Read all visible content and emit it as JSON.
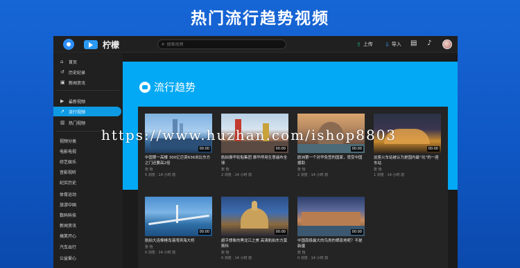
{
  "banner": {
    "title": "热门流行趋势视频"
  },
  "app": {
    "brand": "柠檬",
    "search_placeholder": "搜索视频",
    "upload_label": "上传",
    "import_label": "导入"
  },
  "sidebar": {
    "main_items": [
      {
        "label": "首页",
        "icon": "home-icon"
      },
      {
        "label": "历史纪录",
        "icon": "history-icon"
      },
      {
        "label": "新闻资讯",
        "icon": "news-icon"
      }
    ],
    "video_items": [
      {
        "label": "最新视频",
        "icon": "video-icon"
      },
      {
        "label": "流行视频",
        "icon": "trending-icon",
        "active": true
      },
      {
        "label": "热门视频",
        "icon": "chart-icon"
      }
    ],
    "categories": [
      "视频分类",
      "电影电视",
      "综艺娱乐",
      "音影视听",
      "纪实历史",
      "体育运动",
      "旅游中国",
      "数码科技",
      "新闻资讯",
      "搞笑开心",
      "汽车出行",
      "公益爱心"
    ]
  },
  "main": {
    "hero_title": "流行趋势",
    "hero_color": "#03a9f4",
    "videos": [
      {
        "title": "中国第一高楼 300亿巨资636米比东方之门还要高2倍",
        "author": "张 怡",
        "meta": "5 浏览 · 14 小时 前",
        "duration": "00:00"
      },
      {
        "title": "航拍振华轮船集团 振华停用生意遍布全球",
        "author": "张 怡",
        "meta": "2 浏览 · 14 小时 前",
        "duration": "00:00"
      },
      {
        "title": "欧洲第一个对华免签的国家，竟受中国援助",
        "author": "张 怡",
        "meta": "2 浏览 · 14 小时 前",
        "duration": "00:00"
      },
      {
        "title": "这座火车站被认为是国内最“坑”的一座车站",
        "author": "张 怡",
        "meta": "1 浏览 · 14 小时 前",
        "duration": "00:00"
      },
      {
        "title": "航拍大连棒棰岛港湾滨海大桥",
        "author": "张 怡",
        "meta": "0 浏览 · 14 小时 前",
        "duration": "00:00"
      },
      {
        "title": "超乎想象的黑龙江之美 高清航拍东方莫斯科",
        "author": "张 怡",
        "meta": "0 浏览 · 14 小时 前",
        "duration": "00:00"
      },
      {
        "title": "中国南极最大的鸟类的栖息地呢？不是新疆",
        "author": "张 怡",
        "meta": "0 浏览 · 14 小时 前",
        "duration": "00:00"
      }
    ]
  },
  "watermark": "https://www.huzhan.com/ishop8803"
}
